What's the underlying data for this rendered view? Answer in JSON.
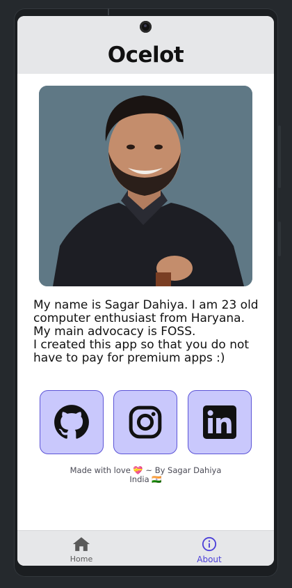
{
  "app": {
    "title": "Ocelot"
  },
  "profile": {
    "photo_alt": "Portrait of Sagar Dahiya",
    "bio_line1": "My name is Sagar Dahiya. I am 23 old computer enthusiast from Haryana. My main advocacy is FOSS.",
    "bio_line2": "I created this app so that you do not have to pay for premium apps :)"
  },
  "socials": [
    {
      "icon": "github-icon"
    },
    {
      "icon": "instagram-icon"
    },
    {
      "icon": "linkedin-icon"
    }
  ],
  "footer": {
    "line1": "Made with love 💝 ~ By Sagar Dahiya",
    "line2": "India 🇮🇳"
  },
  "nav": {
    "home_label": "Home",
    "about_label": "About",
    "active": "About"
  },
  "colors": {
    "accent": "#4b3fd8",
    "social_bg": "#c9c8fc",
    "header_bg": "#e6e7e9"
  }
}
